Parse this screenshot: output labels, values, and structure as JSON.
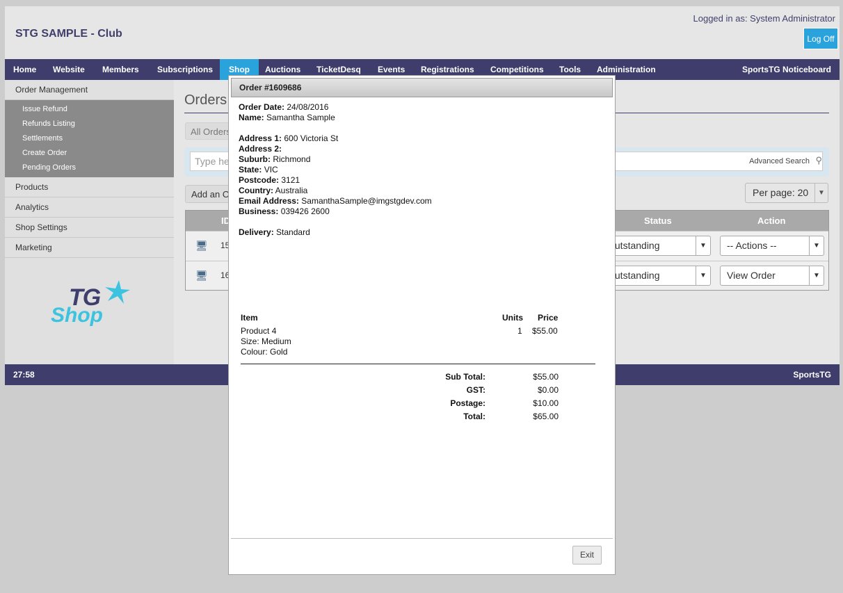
{
  "header": {
    "club_title": "STG SAMPLE - Club",
    "logged_in": "Logged in as: System Administrator",
    "logoff_label": "Log Off"
  },
  "nav": {
    "items": [
      "Home",
      "Website",
      "Members",
      "Subscriptions",
      "Shop",
      "Auctions",
      "TicketDesq",
      "Events",
      "Registrations",
      "Competitions",
      "Tools",
      "Administration"
    ],
    "active": "Shop",
    "right_label": "SportsTG Noticeboard"
  },
  "sidebar": {
    "order_management": "Order Management",
    "sub_items": [
      "Issue Refund",
      "Refunds Listing",
      "Settlements",
      "Create Order",
      "Pending Orders"
    ],
    "items": [
      "Products",
      "Analytics",
      "Shop Settings",
      "Marketing"
    ],
    "logo_tg": "TG",
    "logo_shop": "Shop"
  },
  "main": {
    "title": "Orders",
    "filter": "All Orders",
    "search_placeholder": "Type he",
    "advanced_search": "Advanced Search",
    "add_button": "Add an O",
    "per_page": "Per page: 20",
    "columns": {
      "id": "ID",
      "status": "Status",
      "action": "Action"
    },
    "rows": [
      {
        "id": "15",
        "status": "Outstanding",
        "action": "-- Actions --"
      },
      {
        "id": "16",
        "status": "Outstanding",
        "action": "View Order"
      }
    ]
  },
  "footer": {
    "left": "27:58",
    "right": "SportsTG"
  },
  "modal": {
    "title": "Order #1609686",
    "fields": [
      {
        "label": "Order Date:",
        "value": "24/08/2016"
      },
      {
        "label": "Name:",
        "value": "Samantha Sample"
      },
      {
        "label": "Address 1:",
        "value": "600 Victoria St"
      },
      {
        "label": "Address 2:",
        "value": ""
      },
      {
        "label": "Suburb:",
        "value": "Richmond"
      },
      {
        "label": "State:",
        "value": "VIC"
      },
      {
        "label": "Postcode:",
        "value": "3121"
      },
      {
        "label": "Country:",
        "value": "Australia"
      },
      {
        "label": "Email Address:",
        "value": "SamanthaSample@imgstgdev.com"
      },
      {
        "label": "Business:",
        "value": "039426 2600"
      },
      {
        "label": "Delivery:",
        "value": "Standard"
      }
    ],
    "items_header": {
      "item": "Item",
      "units": "Units",
      "price": "Price"
    },
    "items": [
      {
        "name": "Product 4",
        "details": [
          "Size: Medium",
          "Colour: Gold"
        ],
        "units": "1",
        "price": "$55.00"
      }
    ],
    "totals": [
      {
        "label": "Sub Total:",
        "value": "$55.00"
      },
      {
        "label": "GST:",
        "value": "$0.00"
      },
      {
        "label": "Postage:",
        "value": "$10.00"
      },
      {
        "label": "Total:",
        "value": "$65.00"
      }
    ],
    "exit_label": "Exit"
  }
}
